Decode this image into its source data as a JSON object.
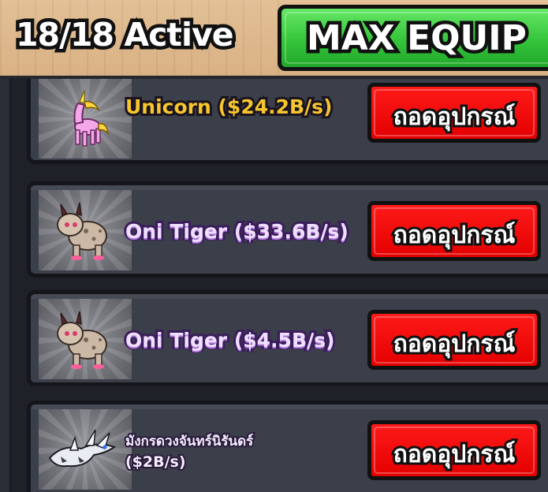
{
  "header": {
    "active_count": "18/18 Active",
    "max_equip_label": "MAX EQUIP"
  },
  "pets": [
    {
      "name": "Unicorn ($24.2B/s)",
      "unequip_label": "ถอดอุปกรณ์",
      "name_color": "#f7c52c"
    },
    {
      "name": "Oni Tiger ($33.6B/s)",
      "unequip_label": "ถอดอุปกรณ์",
      "name_color": "#efe0ff"
    },
    {
      "name": "Oni Tiger ($4.5B/s)",
      "unequip_label": "ถอดอุปกรณ์",
      "name_color": "#efe0ff"
    },
    {
      "name": "มังกรดวงจันทร์นิรันดร์",
      "income": "($2B/s)",
      "unequip_label": "ถอดอุปกรณ์",
      "name_color": "#f4ecff"
    }
  ],
  "colors": {
    "max_equip_green": "#34c43a",
    "unequip_red": "#e40000",
    "header_tan": "#d9b184",
    "card_bg": "#3b3f4a"
  }
}
